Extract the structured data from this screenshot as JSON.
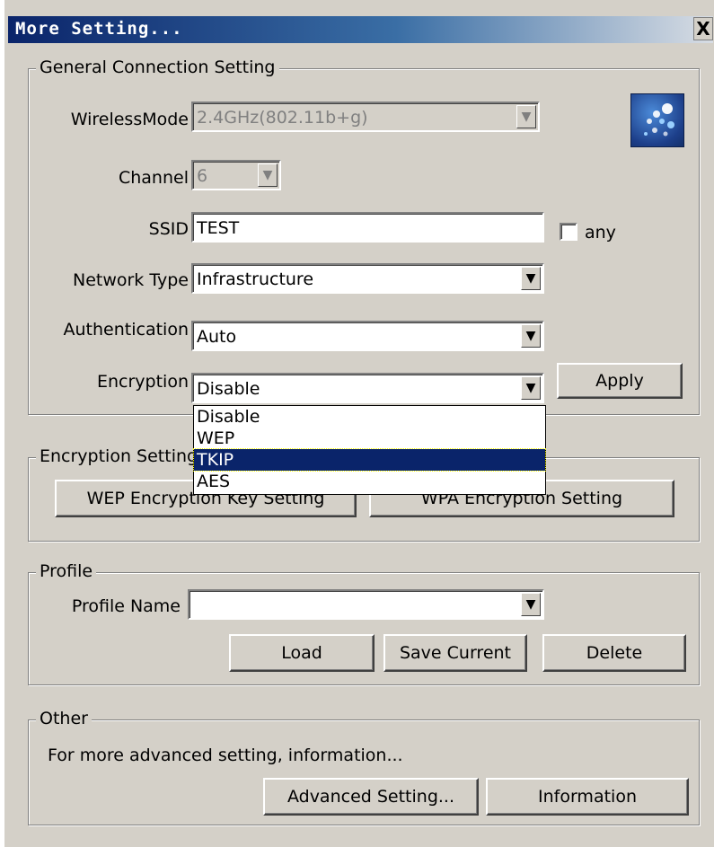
{
  "window": {
    "title": "More Setting...",
    "close_symbol": "X"
  },
  "general": {
    "legend": "General Connection Setting",
    "wireless_mode": {
      "label": "WirelessMode",
      "value": "2.4GHz(802.11b+g)"
    },
    "channel": {
      "label": "Channel",
      "value": "6"
    },
    "ssid": {
      "label": "SSID",
      "value": "TEST",
      "any_label": "any",
      "any_checked": false
    },
    "network_type": {
      "label": "Network Type",
      "value": "Infrastructure"
    },
    "authentication": {
      "label": "Authentication",
      "value": "Auto"
    },
    "encryption": {
      "label": "Encryption",
      "value": "Disable",
      "options": [
        "Disable",
        "WEP",
        "TKIP",
        "AES"
      ],
      "highlighted": "TKIP"
    },
    "apply_label": "Apply"
  },
  "encryption_setting": {
    "legend": "Encryption Setting",
    "wep_button": "WEP Encryption Key Setting",
    "wpa_button": "WPA Encryption Setting"
  },
  "profile": {
    "legend": "Profile",
    "name_label": "Profile Name",
    "name_value": "",
    "load_label": "Load",
    "save_label": "Save Current",
    "delete_label": "Delete"
  },
  "other": {
    "legend": "Other",
    "description": "For more advanced setting, information...",
    "advanced_label": "Advanced Setting...",
    "information_label": "Information"
  },
  "icons": {
    "arrow": "▼",
    "logo": "wireless-logo-icon"
  },
  "colors": {
    "face": "#d4d0c8",
    "title_start": "#0a246a",
    "highlight": "#0a246a"
  }
}
